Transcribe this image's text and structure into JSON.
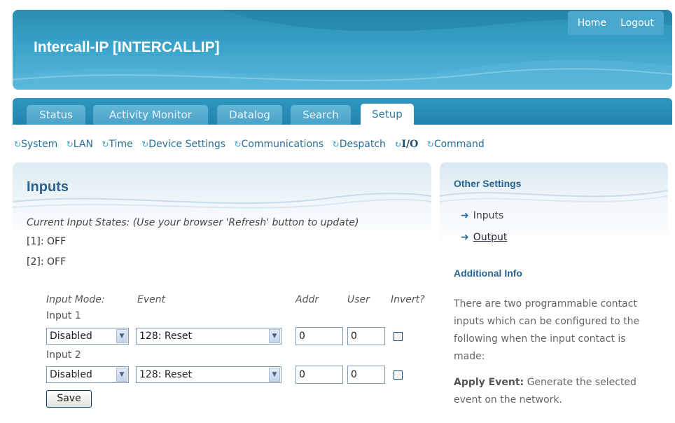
{
  "header": {
    "title": "Intercall-IP [INTERCALLIP]",
    "links": [
      "Home",
      "Logout"
    ]
  },
  "tabs": [
    "Status",
    "Activity Monitor",
    "Datalog",
    "Search",
    "Setup"
  ],
  "active_tab": "Setup",
  "subnav": [
    "System",
    "LAN",
    "Time",
    "Device Settings",
    "Communications",
    "Despatch",
    "I/O",
    "Command"
  ],
  "current_subnav": "I/O",
  "main": {
    "title": "Inputs",
    "states_label": "Current Input States: (Use your browser 'Refresh' button to update)",
    "states": [
      "[1]: OFF",
      "[2]: OFF"
    ],
    "headers": {
      "mode": "Input Mode:",
      "event": "Event",
      "addr": "Addr",
      "user": "User",
      "invert": "Invert?"
    },
    "inputs": [
      {
        "label": "Input 1",
        "mode": "Disabled",
        "event": "128: Reset",
        "addr": "0",
        "user": "0",
        "invert": false
      },
      {
        "label": "Input 2",
        "mode": "Disabled",
        "event": "128: Reset",
        "addr": "0",
        "user": "0",
        "invert": false
      }
    ],
    "save_label": "Save"
  },
  "side": {
    "other_title": "Other Settings",
    "links": [
      "Inputs",
      "Output"
    ],
    "info_title": "Additional Info",
    "info_text": "There are two programmable contact inputs which can be configured to the following when the input contact is made:",
    "apply_label": "Apply Event:",
    "apply_text": " Generate the selected event on the network."
  },
  "colors": {
    "header": "#2a8db3",
    "tab_active_text": "#2c7fa8",
    "heading": "#2a6390"
  }
}
